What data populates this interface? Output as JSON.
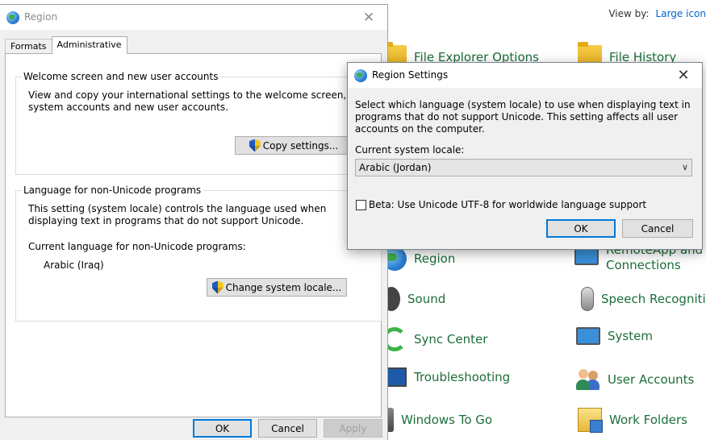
{
  "control_panel": {
    "view_by_label": "View by:",
    "view_by_value": "Large icon",
    "items": [
      {
        "label": "File Explorer Options",
        "icon": "folder-options-icon"
      },
      {
        "label": "File History",
        "icon": "file-history-icon"
      },
      {
        "label": "Region",
        "icon": "region-globe-icon"
      },
      {
        "label": "RemoteApp and Desktop Connections",
        "line1": "RemoteApp and",
        "line2": "Connections",
        "icon": "remote-desktop-icon"
      },
      {
        "label": "Sound",
        "icon": "speaker-icon"
      },
      {
        "label": "Speech Recogniti",
        "icon": "microphone-icon"
      },
      {
        "label": "Sync Center",
        "icon": "sync-icon"
      },
      {
        "label": "System",
        "icon": "computer-icon"
      },
      {
        "label": "Troubleshooting",
        "icon": "troubleshooting-icon"
      },
      {
        "label": "User Accounts",
        "icon": "users-icon"
      },
      {
        "label": "Windows To Go",
        "icon": "usb-drive-icon"
      },
      {
        "label": "Work Folders",
        "icon": "work-folders-icon"
      }
    ]
  },
  "region_dialog": {
    "title": "Region",
    "close_glyph": "✕",
    "tabs": [
      {
        "label": "Formats",
        "active": false
      },
      {
        "label": "Administrative",
        "active": true
      }
    ],
    "welcome_group": {
      "legend": "Welcome screen and new user accounts",
      "description": "View and copy your international settings to the welcome screen, system accounts and new user accounts.",
      "button": "Copy settings..."
    },
    "unicode_group": {
      "legend": "Language for non-Unicode programs",
      "description": "This setting (system locale) controls the language used when displaying text in programs that do not support Unicode.",
      "current_label": "Current language for non-Unicode programs:",
      "current_value": "Arabic (Iraq)",
      "button": "Change system locale..."
    },
    "buttons": {
      "ok": "OK",
      "cancel": "Cancel",
      "apply": "Apply"
    }
  },
  "region_settings_dialog": {
    "title": "Region Settings",
    "close_glyph": "✕",
    "message": "Select which language (system locale) to use when displaying text in programs that do not support Unicode. This setting affects all user accounts on the computer.",
    "locale_label": "Current system locale:",
    "locale_value": "Arabic (Jordan)",
    "chevron": "∨",
    "beta_label": "Beta: Use Unicode UTF-8 for worldwide language support",
    "beta_checked": false,
    "ok": "OK",
    "cancel": "Cancel"
  }
}
